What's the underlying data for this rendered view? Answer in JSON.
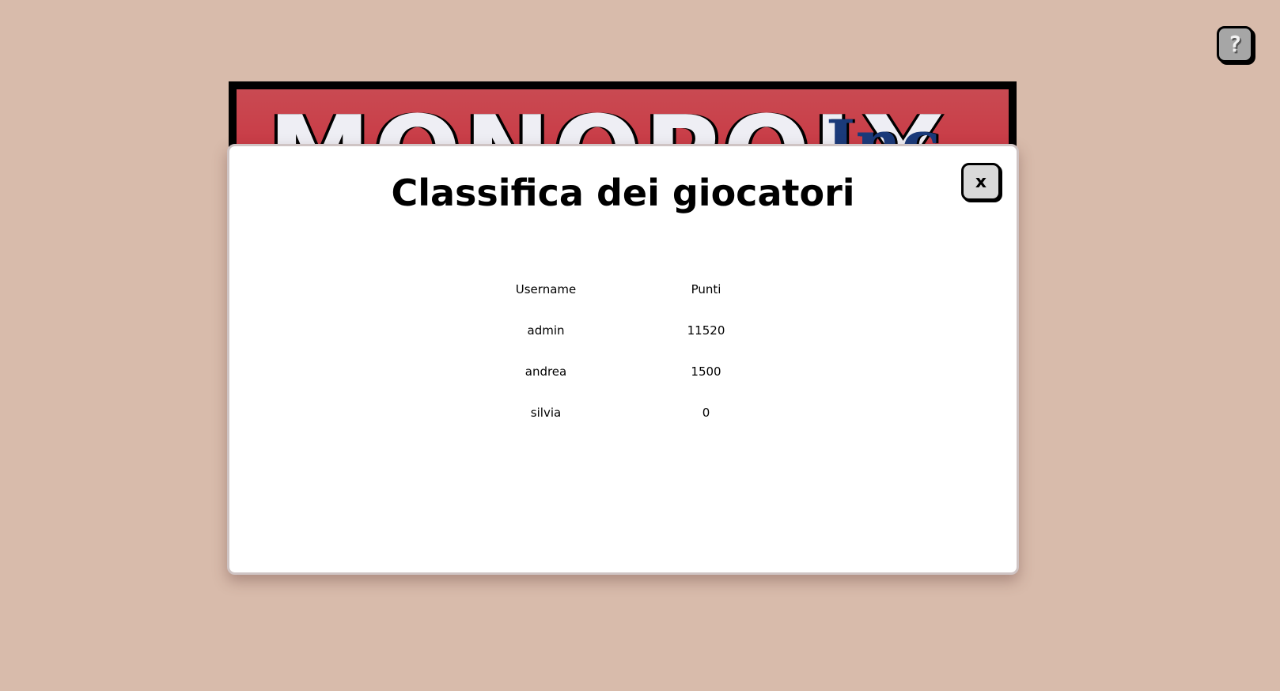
{
  "help_button": {
    "label": "?",
    "icon": "question-mark-icon"
  },
  "logo": {
    "main_text": "MONOPOLY",
    "suffix_text": "Inc"
  },
  "modal": {
    "title": "Classifica dei giocatori",
    "close_label": "x",
    "table": {
      "headers": {
        "username": "Username",
        "points": "Punti"
      },
      "rows": [
        {
          "username": "admin",
          "points": "11520"
        },
        {
          "username": "andrea",
          "points": "1500"
        },
        {
          "username": "silvia",
          "points": "0"
        }
      ]
    }
  },
  "colors": {
    "background": "#d8bbab",
    "banner_red": "#c93a45",
    "banner_blue": "#1a3a7a",
    "modal_bg": "#ffffff",
    "help_button_bg": "#a6a6a6",
    "close_button_bg": "#d9d9d9"
  }
}
